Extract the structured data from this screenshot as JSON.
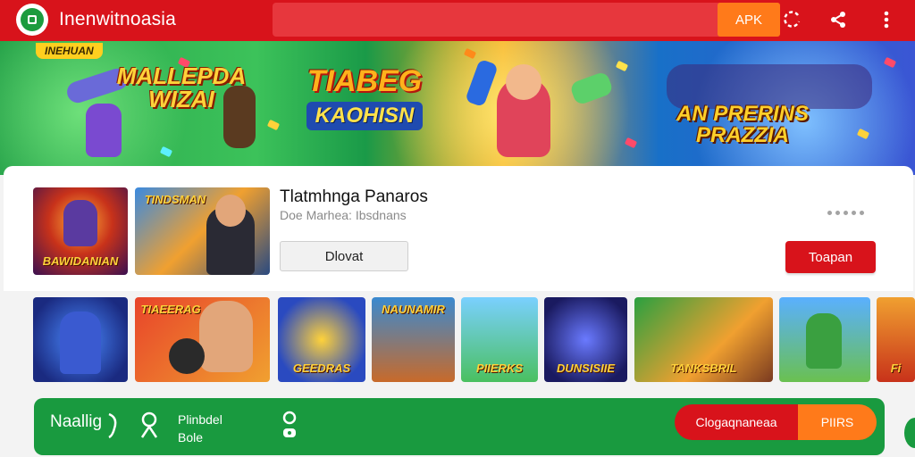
{
  "header": {
    "app_title": "Inenwitnoasia",
    "apk_label": "APK"
  },
  "banner": {
    "corner_label": "INEHUAN",
    "title_left": "MALLEPDA WIZAI",
    "title_center_1": "TIABEG",
    "title_center_2": "KAOHISN",
    "title_right": "AN PRERINS PRAZZIA"
  },
  "game": {
    "title": "Tlatmhnga Panaros",
    "subtitle": "Doe Marhea: Ibsdnans",
    "thumb_left_caption": "BAWIDANIAN",
    "thumb_right_caption": "TINDSMAN",
    "secondary_button": "Dlovat",
    "primary_button": "Toapan"
  },
  "strip": {
    "captions": [
      "",
      "TIAEERAG",
      "GEEDRAS",
      "NAUNAMIR",
      "PIIERKS",
      "DUNSISIIE",
      "TANKSBRIL",
      "",
      "Fi"
    ]
  },
  "bottom": {
    "name": "Naallig",
    "item1_line1": "Plinbdel",
    "item1_line2": "Bole",
    "pill_left": "Clogaqnaneaa",
    "pill_right": "PIIRS"
  },
  "colors": {
    "brand_red": "#d8131b",
    "brand_green": "#199a3f",
    "accent_orange": "#ff7a1a"
  },
  "icons": [
    "app-logo-icon",
    "refresh-icon",
    "share-icon",
    "more-vert-icon",
    "more-horiz-icon",
    "music-icon",
    "person-icon",
    "gamepad-icon"
  ]
}
